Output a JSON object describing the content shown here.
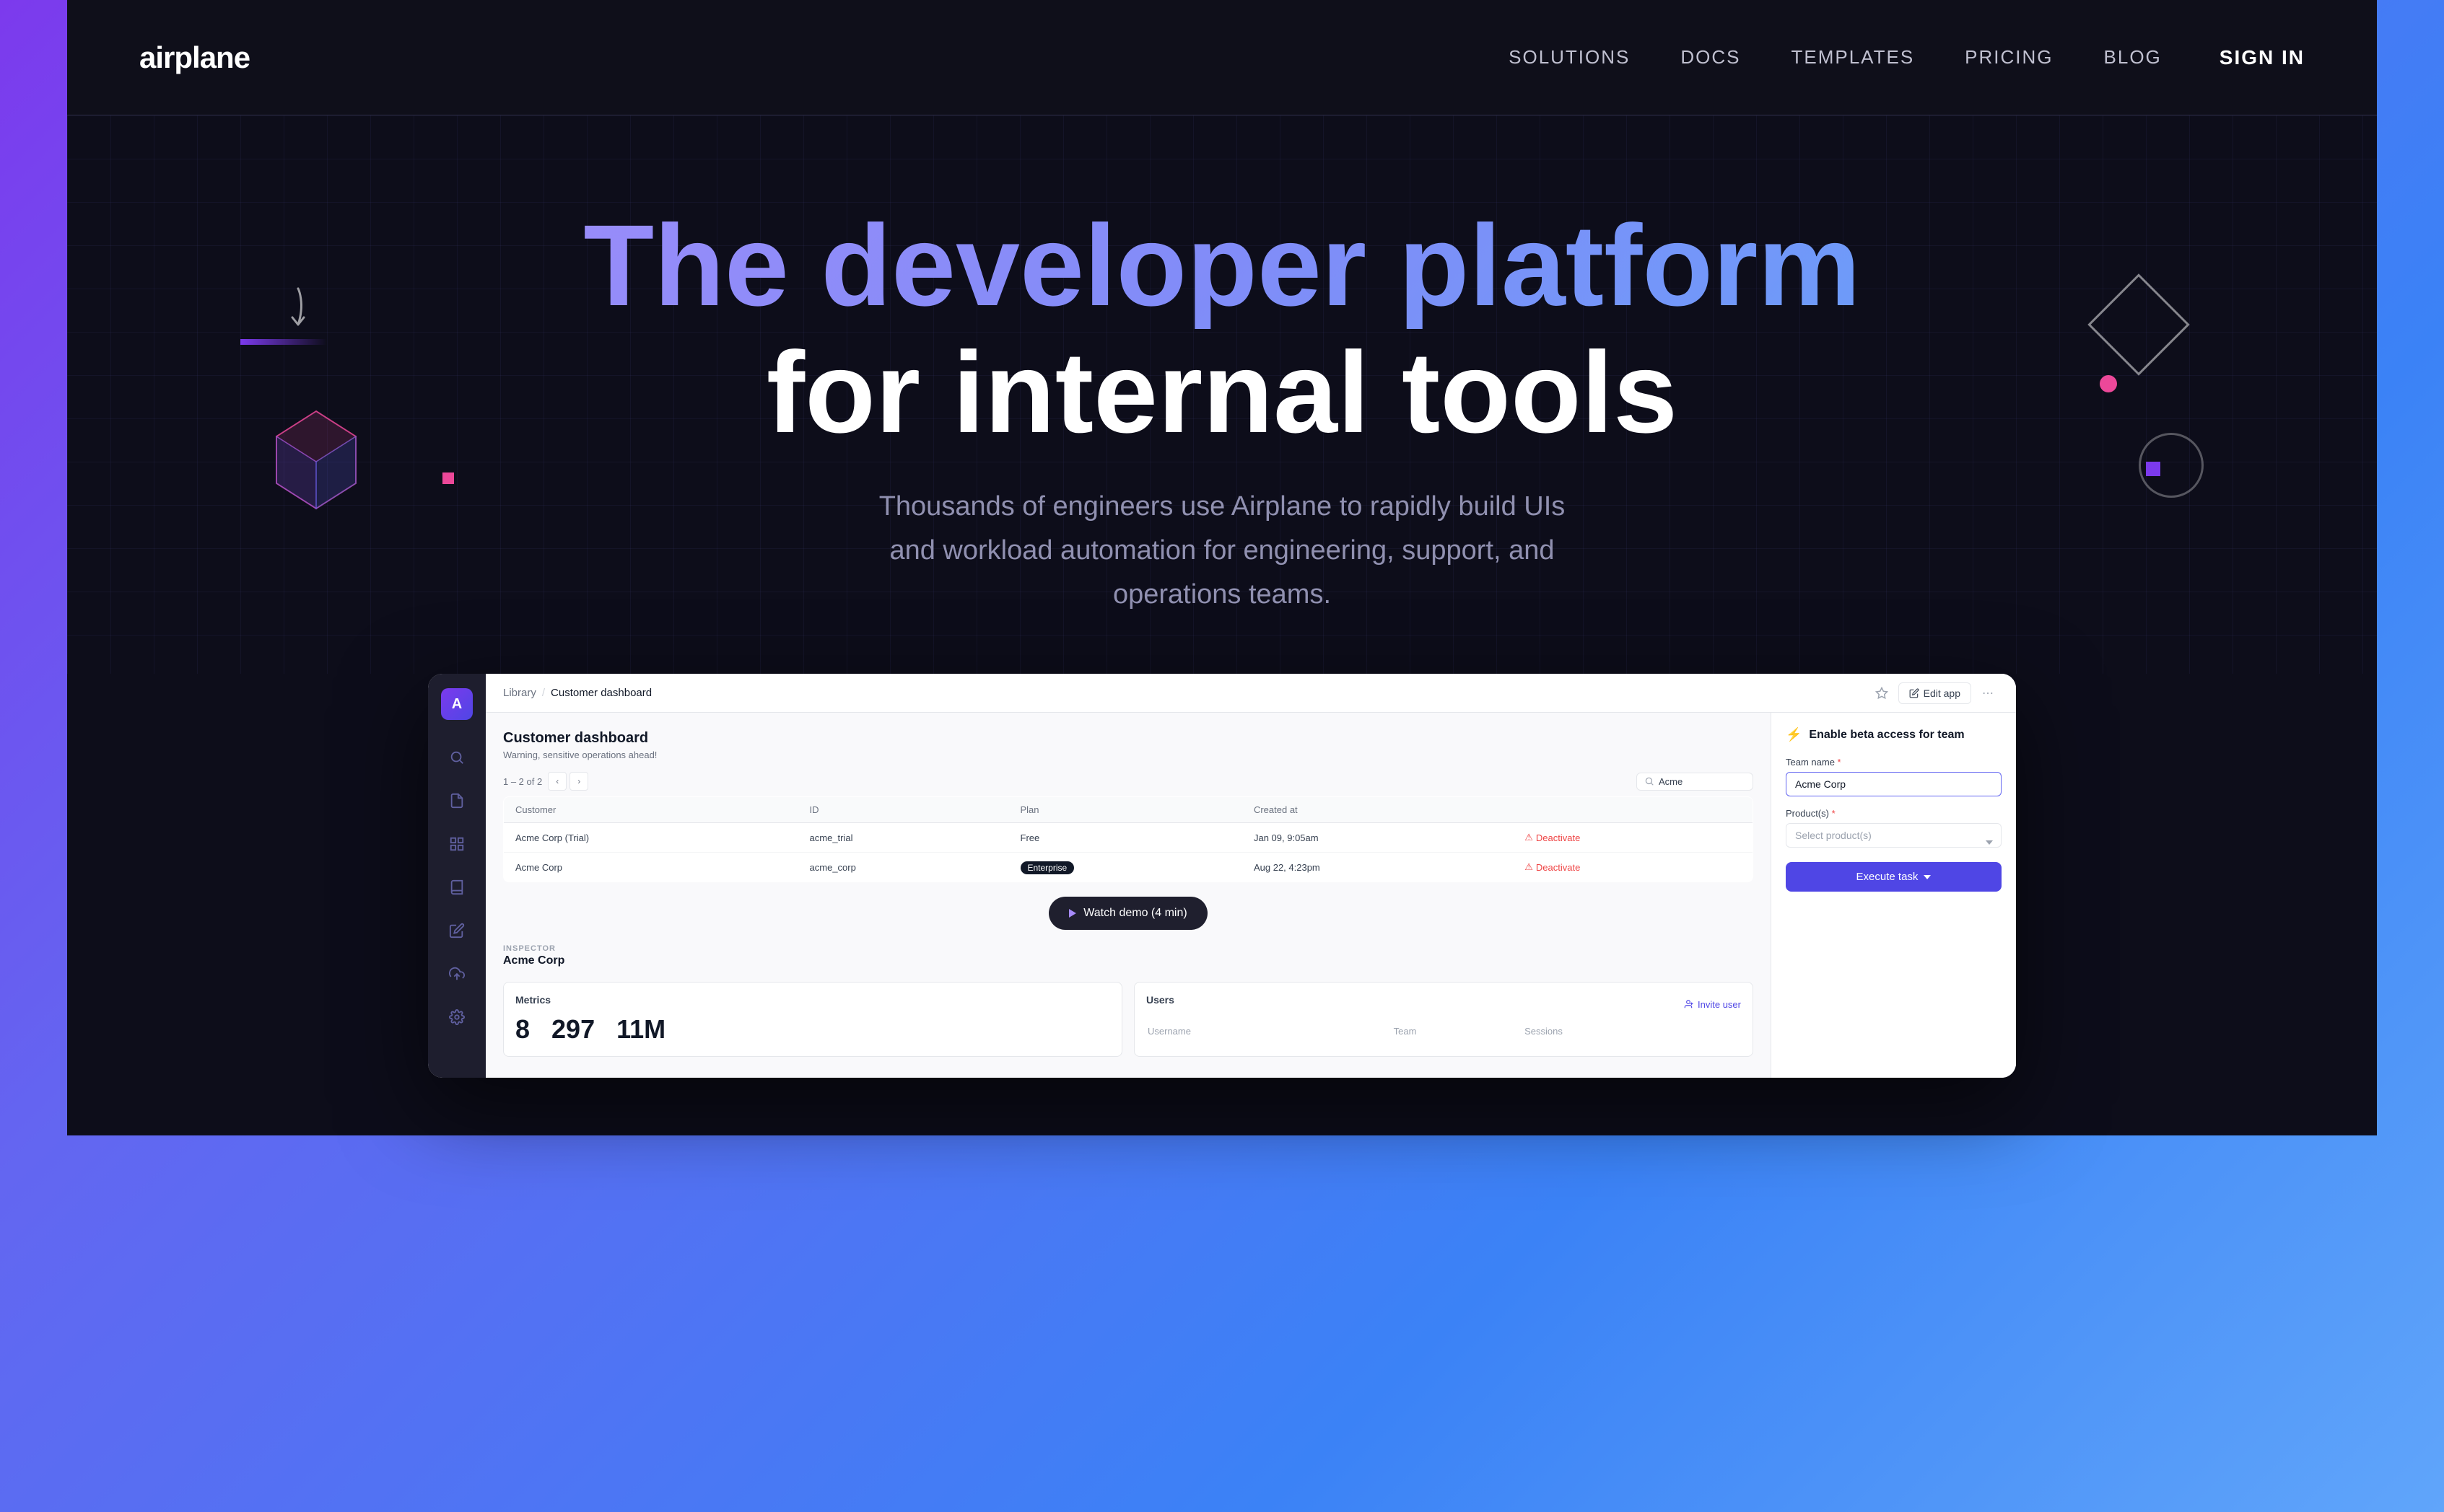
{
  "page": {
    "background": "gradient purple-blue"
  },
  "navbar": {
    "logo": "airplane",
    "links": [
      "SOLUTIONS",
      "DOCS",
      "TEMPLATES",
      "PRICING",
      "BLOG"
    ],
    "sign_in": "SIGN IN"
  },
  "hero": {
    "title_line1": "The developer platform",
    "title_line2": "for internal tools",
    "subtitle": "Thousands of engineers use Airplane to rapidly build UIs\nand workload automation for engineering, support, and\noperations teams."
  },
  "app_demo": {
    "breadcrumb_parent": "Library",
    "breadcrumb_separator": "/",
    "breadcrumb_current": "Customer dashboard",
    "star_label": "star",
    "edit_app_label": "Edit app",
    "more_label": "more options",
    "panel_title": "Customer dashboard",
    "panel_warning": "Warning, sensitive operations ahead!",
    "pagination": "1 – 2 of 2",
    "search_placeholder": "Acme",
    "table": {
      "headers": [
        "Customer",
        "ID",
        "Plan",
        "Created at",
        ""
      ],
      "rows": [
        {
          "customer": "Acme Corp (Trial)",
          "id": "acme_trial",
          "plan": "Free",
          "created_at": "Jan 09, 9:05am",
          "action": "Deactivate"
        },
        {
          "customer": "Acme Corp",
          "id": "acme_corp",
          "plan": "Enterprise",
          "created_at": "Aug 22, 4:23pm",
          "action": "Deactivate"
        }
      ]
    },
    "watch_demo_label": "Watch demo (4 min)",
    "inspector_label": "INSPECTOR",
    "inspector_value": "Acme Corp",
    "metrics": {
      "title": "Metrics",
      "values": [
        "8",
        "297",
        "11M"
      ]
    },
    "users": {
      "title": "Users",
      "invite_label": "Invite user",
      "headers": [
        "Username",
        "Team",
        "Sessions"
      ]
    },
    "right_panel": {
      "title": "Enable beta access for team",
      "team_name_label": "Team name",
      "team_name_required": "*",
      "team_name_value": "Acme Corp",
      "products_label": "Product(s)",
      "products_required": "*",
      "products_placeholder": "Select product(s)",
      "execute_label": "Execute task"
    }
  },
  "icons": {
    "search": "🔍",
    "star": "☆",
    "more": "⋯",
    "lightning": "⚡",
    "warning": "⚠",
    "play": "▶",
    "invite": "👤"
  }
}
